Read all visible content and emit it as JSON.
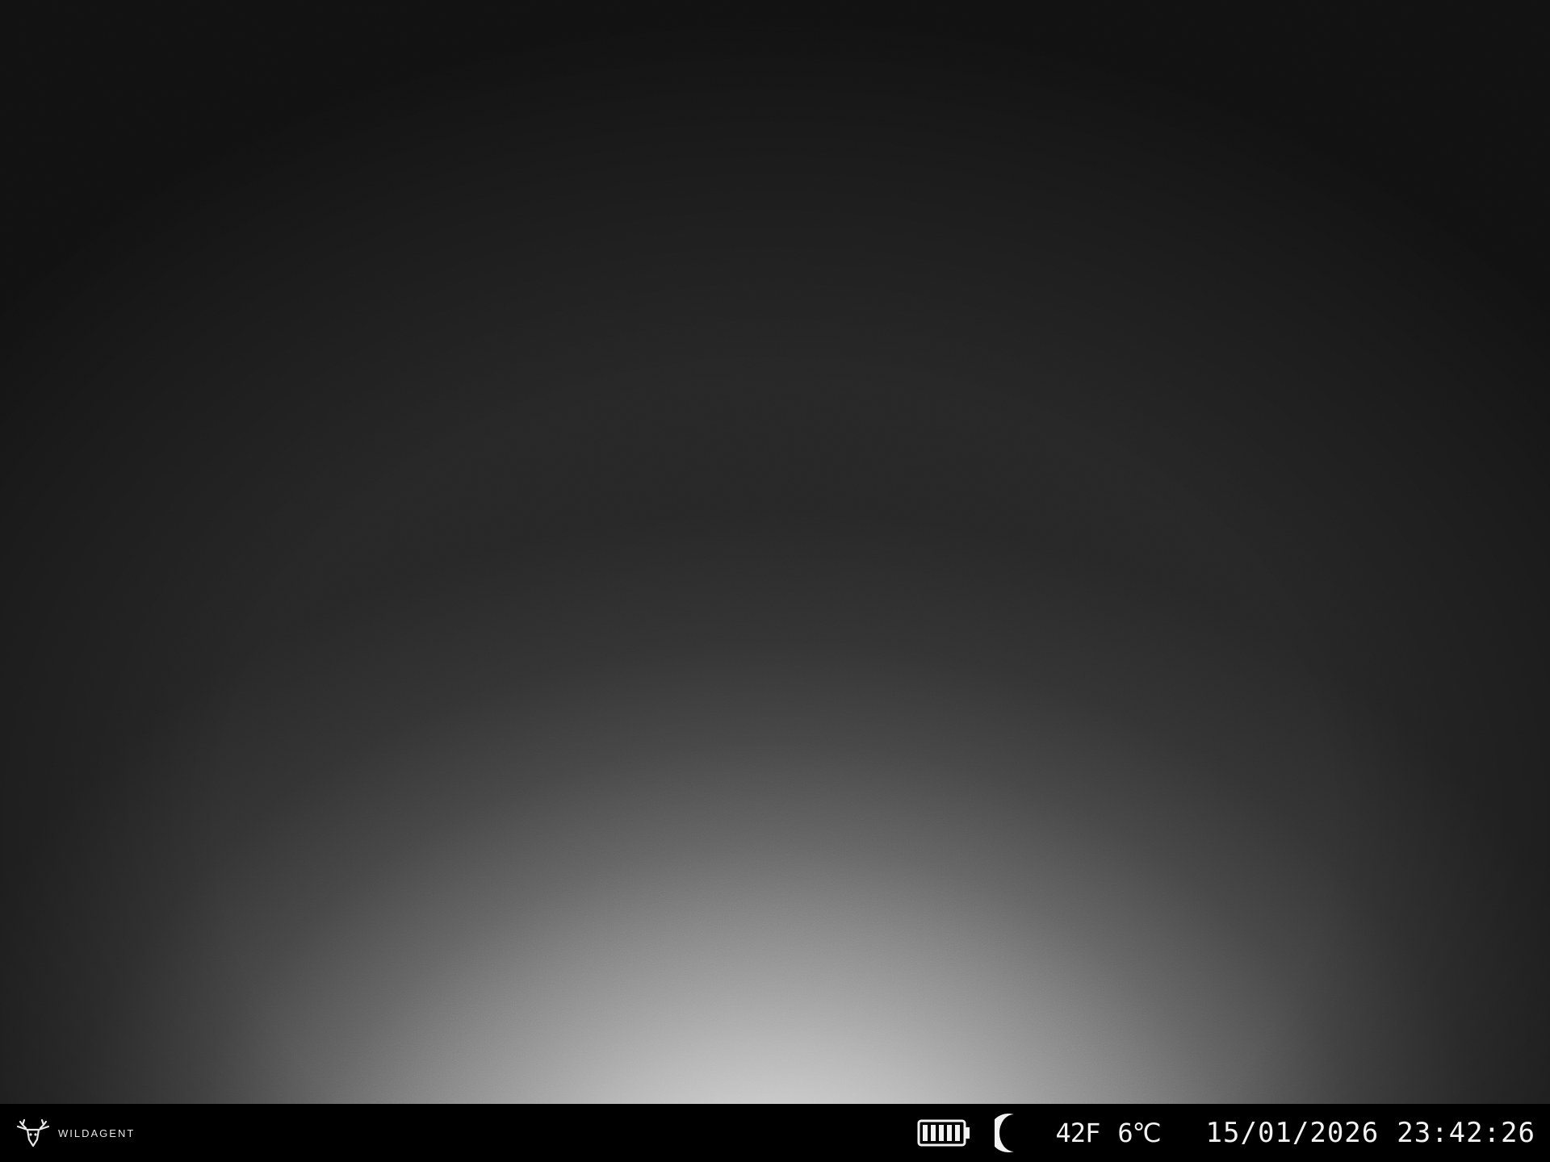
{
  "brand": {
    "name": "WILDAGENT",
    "icon": "deer-head-icon"
  },
  "status": {
    "battery_icon": "battery-full-icon",
    "battery_level": 1.0,
    "mode_icon": "moon-icon",
    "temp_f": "42F",
    "temp_c": "6℃",
    "date": "15/01/2026",
    "time": "23:42:26"
  },
  "colors": {
    "bar_background": "#000000",
    "text": "#f2f2f2"
  }
}
